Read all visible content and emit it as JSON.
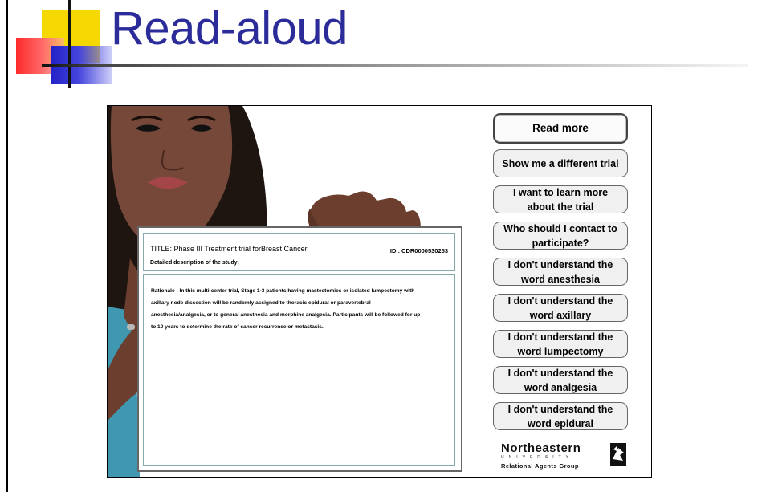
{
  "slide": {
    "title": "Read-aloud"
  },
  "document": {
    "title": "TITLE: Phase III Treatment trial forBreast Cancer.",
    "id": "ID : CDR0000530253",
    "description_label": "Detailed description of the study:",
    "body": "Rationale : In this multi-center trial, Stage 1-3 patients having mastectomies or isolated lumpectomy with axillary node dissection will be randomly assigned to thoracic epidural or paravertebral anesthesia/analgesia, or to general anesthesia and morphine analgesia. Participants will be followed for up to 10 years to determine the rate of cancer recurrence or metastasis."
  },
  "menu": {
    "read_more": "Read more",
    "different_trial": "Show me a different trial",
    "learn_more": "I want to learn more about the trial",
    "contact": "Who should I contact to participate?",
    "anesthesia": "I don't understand the word anesthesia",
    "axillary": "I don't understand the word axillary",
    "lumpectomy": "I don't understand the word lumpectomy",
    "analgesia": "I don't understand the word analgesia",
    "epidural": "I don't understand the word epidural"
  },
  "branding": {
    "name": "Northeastern",
    "subtitle": "UNIVERSITY",
    "group": "Relational Agents Group",
    "logo_icon": "northeastern-seal-icon"
  },
  "colors": {
    "title_blue": "#2b2b9a",
    "shirt_teal": "#3f97b0",
    "skin": "#6b3e2e",
    "hair": "#1e1410"
  }
}
